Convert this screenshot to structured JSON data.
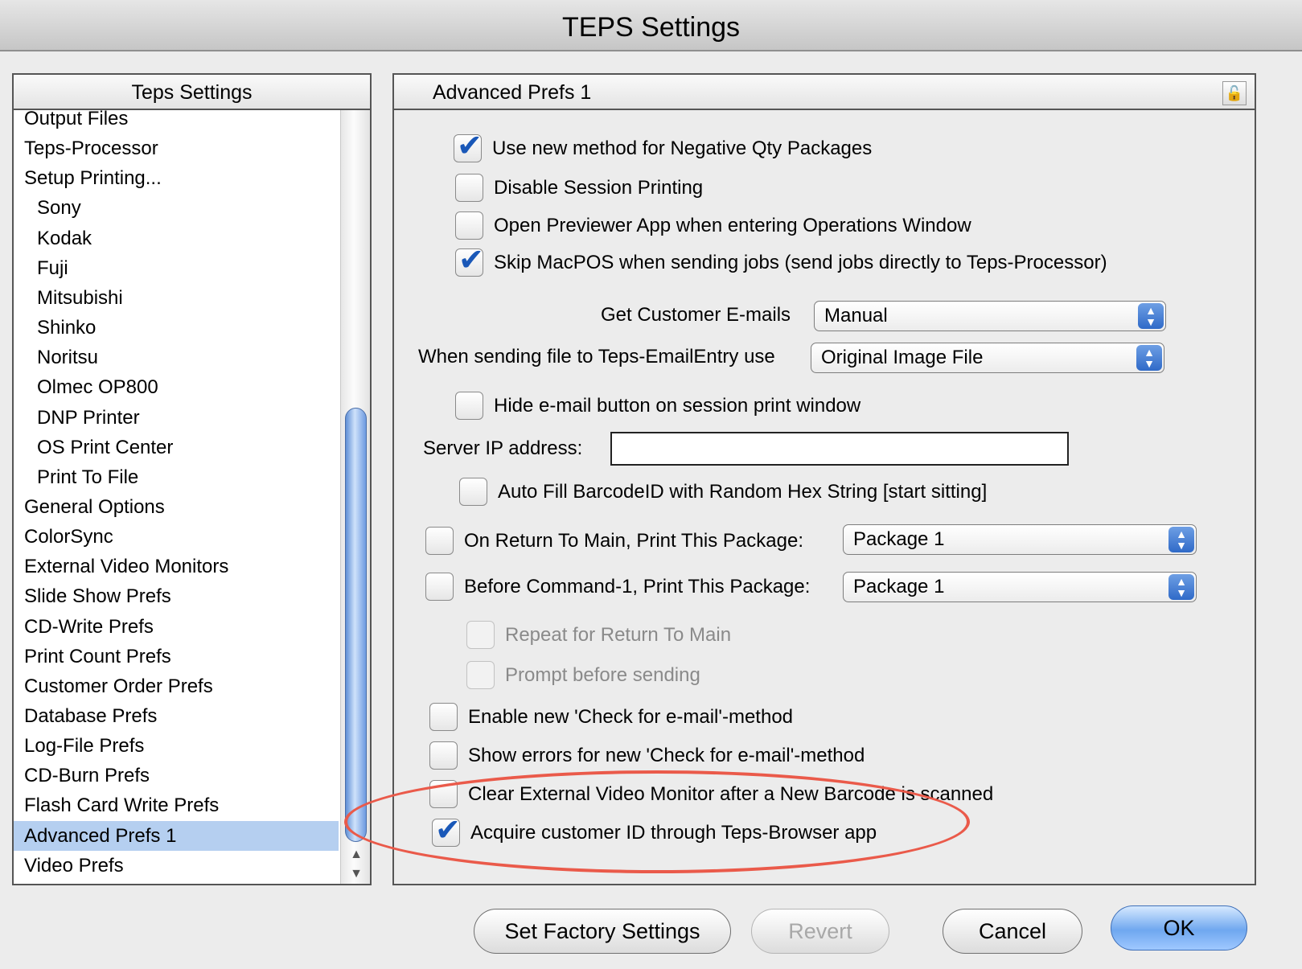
{
  "window": {
    "title": "TEPS Settings"
  },
  "sidebar": {
    "header": "Teps Settings",
    "items": [
      {
        "label": "Output Files",
        "level": 0,
        "selected": false
      },
      {
        "label": "Teps-Processor",
        "level": 0,
        "selected": false
      },
      {
        "label": "Setup Printing...",
        "level": 0,
        "selected": false
      },
      {
        "label": "Sony",
        "level": 1,
        "selected": false
      },
      {
        "label": "Kodak",
        "level": 1,
        "selected": false
      },
      {
        "label": "Fuji",
        "level": 1,
        "selected": false
      },
      {
        "label": "Mitsubishi",
        "level": 1,
        "selected": false
      },
      {
        "label": "Shinko",
        "level": 1,
        "selected": false
      },
      {
        "label": "Noritsu",
        "level": 1,
        "selected": false
      },
      {
        "label": "Olmec OP800",
        "level": 1,
        "selected": false
      },
      {
        "label": "DNP Printer",
        "level": 1,
        "selected": false
      },
      {
        "label": "OS Print Center",
        "level": 1,
        "selected": false
      },
      {
        "label": "Print To File",
        "level": 1,
        "selected": false
      },
      {
        "label": "General Options",
        "level": 0,
        "selected": false
      },
      {
        "label": "ColorSync",
        "level": 0,
        "selected": false
      },
      {
        "label": "External Video Monitors",
        "level": 0,
        "selected": false
      },
      {
        "label": "Slide Show Prefs",
        "level": 0,
        "selected": false
      },
      {
        "label": "CD-Write Prefs",
        "level": 0,
        "selected": false
      },
      {
        "label": "Print Count Prefs",
        "level": 0,
        "selected": false
      },
      {
        "label": "Customer Order Prefs",
        "level": 0,
        "selected": false
      },
      {
        "label": "Database Prefs",
        "level": 0,
        "selected": false
      },
      {
        "label": "Log-File Prefs",
        "level": 0,
        "selected": false
      },
      {
        "label": "CD-Burn Prefs",
        "level": 0,
        "selected": false
      },
      {
        "label": "Flash Card Write Prefs",
        "level": 0,
        "selected": false
      },
      {
        "label": "Advanced Prefs 1",
        "level": 0,
        "selected": true
      },
      {
        "label": "Video Prefs",
        "level": 0,
        "selected": false
      }
    ]
  },
  "panel": {
    "title": "Advanced Prefs 1",
    "neg_qty": {
      "label": "Use new method for Negative Qty Packages",
      "checked": true
    },
    "disable_session": {
      "label": "Disable Session Printing",
      "checked": false
    },
    "open_previewer": {
      "label": "Open Previewer App when entering Operations Window",
      "checked": false
    },
    "skip_macpos": {
      "label": "Skip MacPOS when sending jobs (send jobs directly to Teps-Processor)",
      "checked": true
    },
    "get_emails": {
      "label": "Get Customer E-mails",
      "value": "Manual"
    },
    "email_entry": {
      "label": "When sending file to Teps-EmailEntry use",
      "value": "Original Image File"
    },
    "hide_email": {
      "label": "Hide e-mail button on session print window",
      "checked": false
    },
    "server_ip": {
      "label": "Server IP address:",
      "value": ""
    },
    "auto_fill": {
      "label": "Auto Fill  BarcodeID with Random Hex String [start sitting]",
      "checked": false
    },
    "return_main": {
      "label": "On Return To Main, Print This Package:",
      "checked": false,
      "value": "Package 1"
    },
    "before_cmd": {
      "label": "Before Command-1, Print This Package:",
      "checked": false,
      "value": "Package 1"
    },
    "repeat_return": {
      "label": "Repeat for Return To Main",
      "checked": false,
      "enabled": false
    },
    "prompt_send": {
      "label": "Prompt before sending",
      "checked": false,
      "enabled": false
    },
    "enable_check": {
      "label": "Enable new 'Check for e-mail'-method",
      "checked": false
    },
    "show_errors": {
      "label": "Show errors for new 'Check for e-mail'-method",
      "checked": false
    },
    "clear_monitor": {
      "label": "Clear External Video Monitor after a New Barcode is scanned",
      "checked": false
    },
    "acquire_id": {
      "label": "Acquire customer ID through Teps-Browser app",
      "checked": true
    }
  },
  "buttons": {
    "factory": "Set Factory Settings",
    "revert": "Revert",
    "cancel": "Cancel",
    "ok": "OK"
  },
  "icons": {
    "lock": "lock-icon",
    "scroll_up": "scroll-up-arrow-icon",
    "scroll_down": "scroll-down-arrow-icon",
    "popup_arrows": "popup-arrows-icon"
  },
  "colors": {
    "selection": "#b5cff0",
    "accent": "#2f6ac8",
    "annotation": "#ea5a4a"
  }
}
